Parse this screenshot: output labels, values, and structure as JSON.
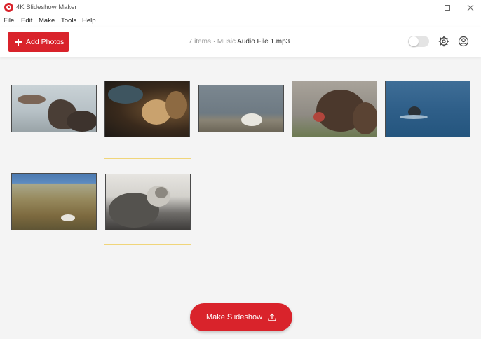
{
  "window": {
    "title": "4K Slideshow Maker"
  },
  "menu": [
    "File",
    "Edit",
    "Make",
    "Tools",
    "Help"
  ],
  "toolbar": {
    "add_photos_label": "Add Photos",
    "status_items": "7 items",
    "status_separator": " · ",
    "status_music_label": "Music ",
    "status_music_file": "Audio File 1.mp3",
    "toggle_on": false
  },
  "photos": [
    {
      "subject": "fur seal on sand",
      "selected": false
    },
    {
      "subject": "sea lions on rocks",
      "selected": false
    },
    {
      "subject": "white seal pup on beach",
      "selected": false
    },
    {
      "subject": "fur seal roaring",
      "selected": false
    },
    {
      "subject": "seal head in water",
      "selected": false
    },
    {
      "subject": "seal pup in grass",
      "selected": false
    },
    {
      "subject": "seal on pebbles",
      "selected": true
    }
  ],
  "footer": {
    "make_slideshow_label": "Make Slideshow"
  },
  "colors": {
    "accent": "#d9232b",
    "selection": "#f0d57a",
    "background": "#f4f4f4"
  },
  "icons": [
    "app-logo-icon",
    "plus-icon",
    "gear-icon",
    "account-icon",
    "share-upload-icon",
    "minimize-icon",
    "maximize-icon",
    "close-icon"
  ]
}
